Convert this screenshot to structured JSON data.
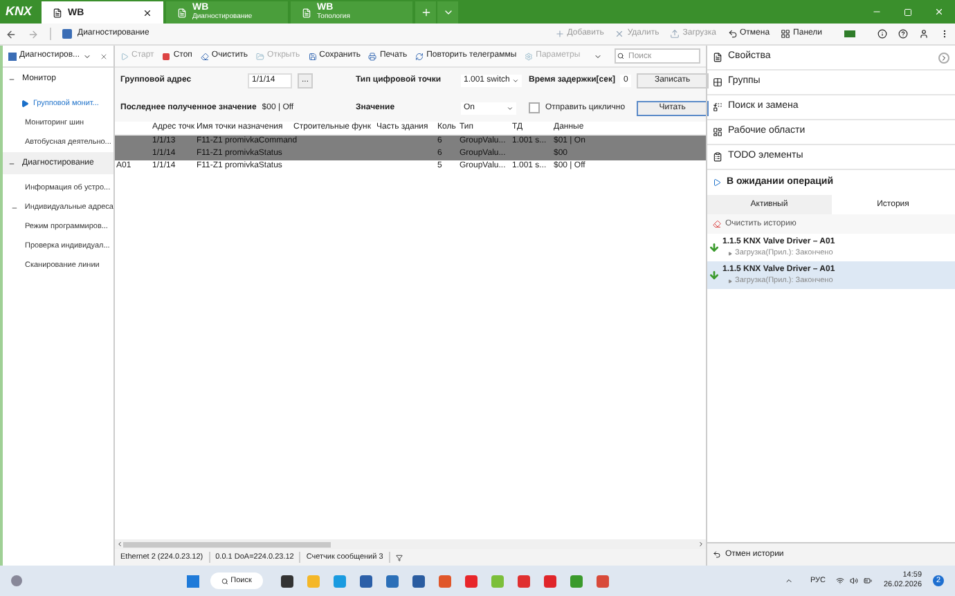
{
  "title_bar": {
    "logo": "KNX",
    "tabs": [
      {
        "title": "WB",
        "selected": true
      },
      {
        "title": "WB",
        "subtitle": "Диагностирование",
        "selected": false
      },
      {
        "title": "WB",
        "subtitle": "Топология",
        "selected": false
      }
    ]
  },
  "toolbar": {
    "breadcrumb": "Диагностирование",
    "actions": [
      {
        "label": "Добавить",
        "disabled": true
      },
      {
        "label": "Удалить",
        "disabled": true
      },
      {
        "label": "Загрузка",
        "disabled": true
      },
      {
        "label": "Отмена",
        "disabled": false
      },
      {
        "label": "Панели",
        "disabled": false
      }
    ]
  },
  "sidebar": {
    "selector": "Диагностиров...",
    "sections": [
      {
        "label": "Монитор",
        "expanded": true,
        "children": [
          {
            "label": "Групповой монит...",
            "selected": true
          },
          {
            "label": "Мониторинг шин",
            "selected": false
          },
          {
            "label": "Автобусная деятельно...",
            "selected": false
          }
        ]
      },
      {
        "label": "Диагностирование",
        "expanded": true,
        "children": [
          {
            "label": "Информация об устро...",
            "selected": false
          },
          {
            "label": "Индивидуальные адреса",
            "selected": false,
            "expanded": true
          },
          {
            "label": "Режим программиров...",
            "selected": false
          },
          {
            "label": "Проверка индивидуал...",
            "selected": false
          },
          {
            "label": "Сканирование линии",
            "selected": false
          }
        ]
      }
    ]
  },
  "monitor_toolbar": {
    "buttons": [
      {
        "label": "Старт",
        "disabled": true
      },
      {
        "label": "Стоп",
        "disabled": false
      },
      {
        "label": "Очистить",
        "disabled": false
      },
      {
        "label": "Открыть",
        "disabled": true
      },
      {
        "label": "Сохранить",
        "disabled": false
      },
      {
        "label": "Печать",
        "disabled": false
      },
      {
        "label": "Повторить телеграммы",
        "disabled": false
      },
      {
        "label": "Параметры",
        "disabled": true
      }
    ],
    "search": {
      "placeholder": "Поиск"
    }
  },
  "form": {
    "group_address_label": "Групповой адрес",
    "group_address": "1/1/14",
    "browse": "...",
    "dpt_label": "Тип цифровой точки",
    "dpt": "1.001 switch",
    "delay_label": "Время задержки[сек]",
    "delay": "0",
    "write": "Записать",
    "last_value_label": "Последнее полученное значение",
    "last_value": "$00 | Off",
    "value_label": "Значение",
    "value": "On",
    "cyclic_label": "Отправить циклично",
    "cyclic": false,
    "read": "Читать"
  },
  "table": {
    "columns": [
      "Адрес точк",
      "Имя точки назначения",
      "Строительные функ",
      "Часть здания",
      "Коль",
      "Тип",
      "ТД",
      "Данные"
    ],
    "rows": [
      {
        "selected": true,
        "address": "1/1/13",
        "name": "F11-Z1 promivkaCommand",
        "count": "6",
        "type": "GroupValu...",
        "dpt": "1.001 s...",
        "data": "$01 | On"
      },
      {
        "selected": true,
        "address": "1/1/14",
        "name": "F11-Z1 promivkaStatus",
        "count": "6",
        "type": "GroupValu...",
        "data": "$00"
      },
      {
        "selected": false,
        "column_1": "A01",
        "address": "1/1/14",
        "name": "F11-Z1 promivkaStatus",
        "count": "5",
        "type": "GroupValu...",
        "dpt": "1.001 s...",
        "data": "$00 | Off"
      }
    ]
  },
  "status_bar": [
    "Ethernet 2 (224.0.23.12)",
    "0.0.1 DoA=224.0.23.12",
    "Счетчик сообщений 3"
  ],
  "right_panel": {
    "panels": [
      "Свойства",
      "Группы",
      "Поиск и замена",
      "Рабочие области",
      "TODO элементы"
    ],
    "pending_title": "В ожидании операций",
    "tabs": [
      {
        "label": "Активный",
        "selected": false
      },
      {
        "label": "История",
        "selected": true
      }
    ],
    "clear": "Очистить историю",
    "history": [
      {
        "title": "1.1.5 KNX Valve Driver – A01",
        "detail": "Загрузка(Прил.): Закончено",
        "selected": false
      },
      {
        "title": "1.1.5 KNX Valve Driver – A01",
        "detail": "Загрузка(Прил.): Закончено",
        "selected": true
      }
    ],
    "undo_history": "Отмен истории"
  },
  "taskbar": {
    "search": "Поиск",
    "language": "РУС",
    "time": "14:59",
    "date": "26.02.2026",
    "notifications": "2"
  }
}
